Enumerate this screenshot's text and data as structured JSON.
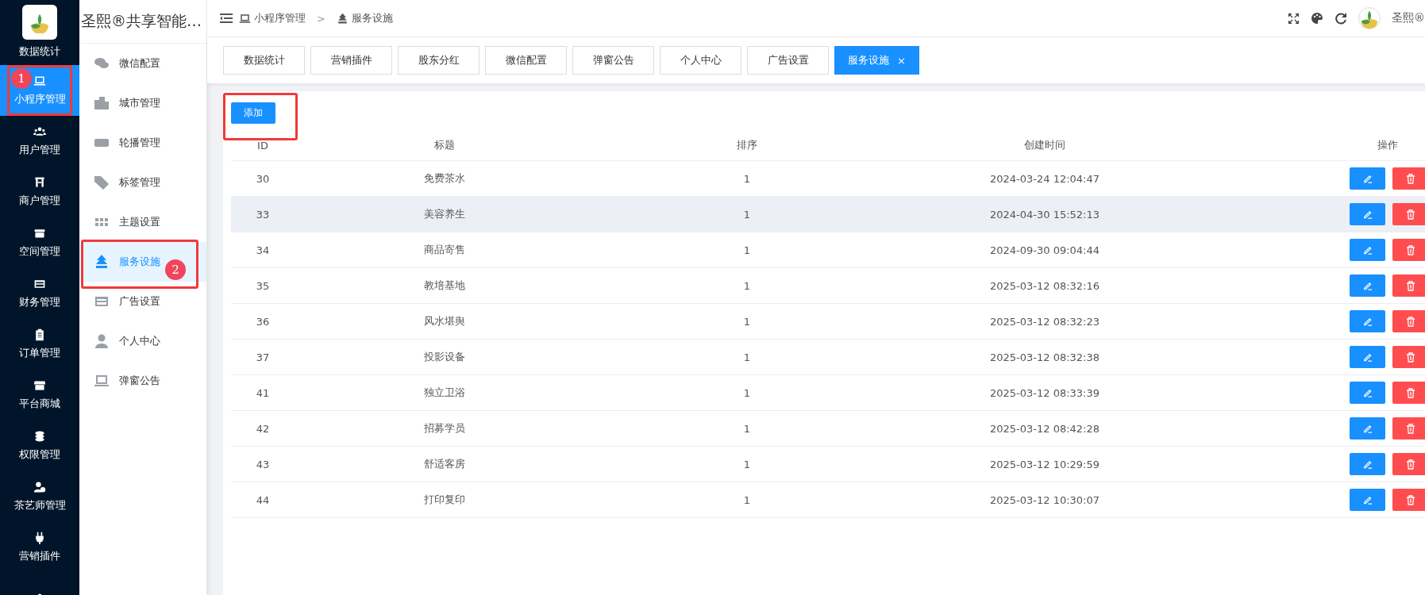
{
  "rail": {
    "items": [
      {
        "label": "数据统计",
        "selected": false,
        "marked": false
      },
      {
        "label": "小程序管理",
        "selected": true,
        "marked": true,
        "badge": "1"
      },
      {
        "label": "用户管理",
        "selected": false,
        "marked": false
      },
      {
        "label": "商户管理",
        "selected": false,
        "marked": false
      },
      {
        "label": "空间管理",
        "selected": false,
        "marked": false
      },
      {
        "label": "财务管理",
        "selected": false,
        "marked": false
      },
      {
        "label": "订单管理",
        "selected": false,
        "marked": false
      },
      {
        "label": "平台商城",
        "selected": false,
        "marked": false
      },
      {
        "label": "权限管理",
        "selected": false,
        "marked": false
      },
      {
        "label": "茶艺师管理",
        "selected": false,
        "marked": false
      },
      {
        "label": "营销插件",
        "selected": false,
        "marked": false
      },
      {
        "selected": false
      }
    ]
  },
  "submenu": {
    "title": "圣熙®共享智能…",
    "items": [
      {
        "label": "微信配置",
        "selected": false,
        "marked": false
      },
      {
        "label": "城市管理",
        "selected": false,
        "marked": false
      },
      {
        "label": "轮播管理",
        "selected": false,
        "marked": false
      },
      {
        "label": "标签管理",
        "selected": false,
        "marked": false
      },
      {
        "label": "主题设置",
        "selected": false,
        "marked": false
      },
      {
        "label": "服务设施",
        "selected": true,
        "marked": true,
        "badge": "2"
      },
      {
        "label": "广告设置",
        "selected": false,
        "marked": false
      },
      {
        "label": "个人中心",
        "selected": false,
        "marked": false
      },
      {
        "label": "弹窗公告",
        "selected": false,
        "marked": false
      }
    ]
  },
  "header": {
    "breadcrumb": [
      {
        "label": "小程序管理"
      },
      {
        "label": "服务设施"
      }
    ],
    "separator": ">",
    "user_name": "圣熙®"
  },
  "tabs": [
    {
      "label": "数据统计",
      "selected": false
    },
    {
      "label": "营销插件",
      "selected": false
    },
    {
      "label": "股东分红",
      "selected": false
    },
    {
      "label": "微信配置",
      "selected": false
    },
    {
      "label": "弹窗公告",
      "selected": false
    },
    {
      "label": "个人中心",
      "selected": false
    },
    {
      "label": "广告设置",
      "selected": false
    },
    {
      "label": "服务设施",
      "selected": true,
      "close": "×"
    }
  ],
  "add_button": {
    "label": "添加",
    "marked": true
  },
  "table": {
    "columns": [
      "ID",
      "标题",
      "排序",
      "创建时间",
      "操作"
    ],
    "rows": [
      {
        "id": "30",
        "title": "免费茶水",
        "sort": "1",
        "created": "2024-03-24 12:04:47",
        "highlighted": false
      },
      {
        "id": "33",
        "title": "美容养生",
        "sort": "1",
        "created": "2024-04-30 15:52:13",
        "highlighted": true
      },
      {
        "id": "34",
        "title": "商品寄售",
        "sort": "1",
        "created": "2024-09-30 09:04:44",
        "highlighted": false
      },
      {
        "id": "35",
        "title": "教培基地",
        "sort": "1",
        "created": "2025-03-12 08:32:16",
        "highlighted": false
      },
      {
        "id": "36",
        "title": "风水堪舆",
        "sort": "1",
        "created": "2025-03-12 08:32:23",
        "highlighted": false
      },
      {
        "id": "37",
        "title": "投影设备",
        "sort": "1",
        "created": "2025-03-12 08:32:38",
        "highlighted": false
      },
      {
        "id": "41",
        "title": "独立卫浴",
        "sort": "1",
        "created": "2025-03-12 08:33:39",
        "highlighted": false
      },
      {
        "id": "42",
        "title": "招募学员",
        "sort": "1",
        "created": "2025-03-12 08:42:28",
        "highlighted": false
      },
      {
        "id": "43",
        "title": "舒适客房",
        "sort": "1",
        "created": "2025-03-12 10:29:59",
        "highlighted": false
      },
      {
        "id": "44",
        "title": "打印复印",
        "sort": "1",
        "created": "2025-03-12 10:30:07",
        "highlighted": false
      }
    ]
  }
}
